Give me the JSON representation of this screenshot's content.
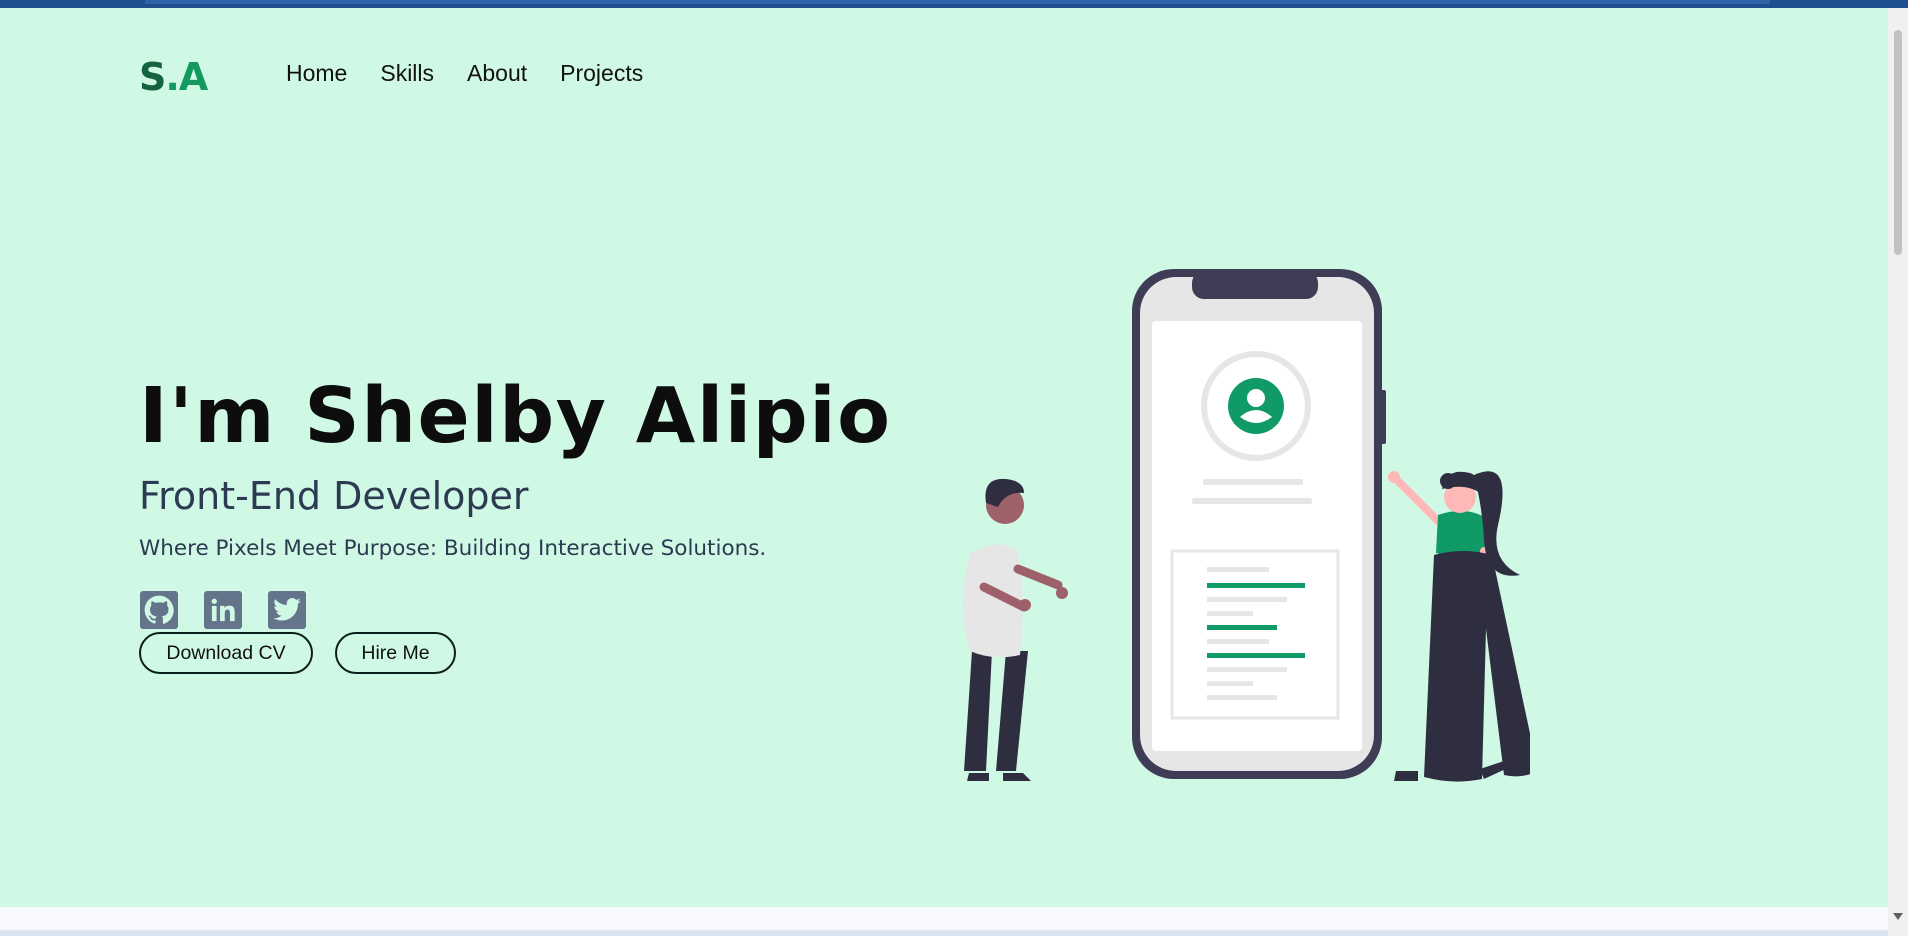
{
  "logo": {
    "initial_s": "S",
    "dot": ".",
    "initial_a": "A"
  },
  "nav": {
    "items": [
      {
        "label": "Home"
      },
      {
        "label": "Skills"
      },
      {
        "label": "About"
      },
      {
        "label": "Projects"
      }
    ]
  },
  "hero": {
    "title": "I'm Shelby Alipio",
    "role": "Front-End Developer",
    "tagline": "Where Pixels Meet Purpose: Building Interactive Solutions."
  },
  "socials": [
    {
      "icon": "github-icon"
    },
    {
      "icon": "linkedin-icon"
    },
    {
      "icon": "twitter-icon"
    }
  ],
  "buttons": {
    "download_cv": "Download CV",
    "hire_me": "Hire Me"
  },
  "colors": {
    "background": "#d0f9e5",
    "brand_dark": "#14623f",
    "brand_accent": "#13995e",
    "text_secondary": "#2d3b52",
    "icon_gray": "#64748b"
  }
}
